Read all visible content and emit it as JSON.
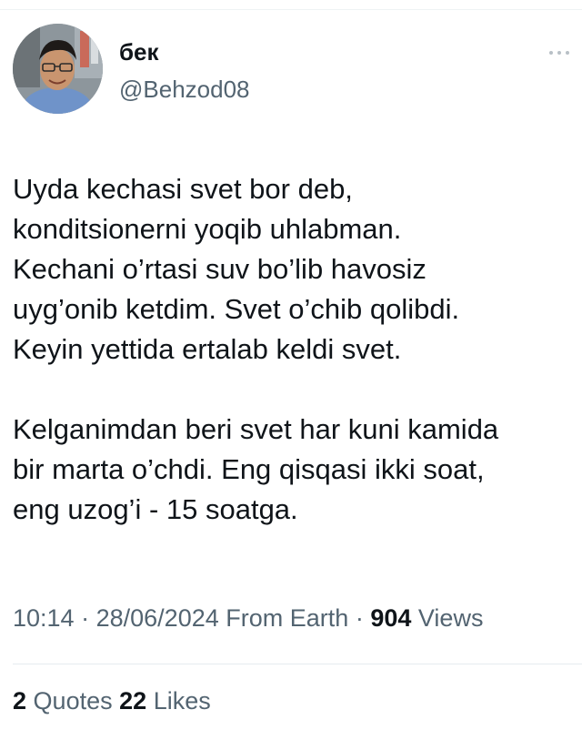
{
  "author": {
    "display_name": "бек",
    "handle": "@Behzod08"
  },
  "tweet": {
    "paragraphs": [
      "Uyda kechasi svet bor deb,\nkonditsionerni yoqib uhlabman.\nKechani o’rtasi suv bo’lib havosiz\nuyg’onib ketdim. Svet o’chib qolibdi.\nKeyin yettida ertalab keldi svet.",
      "Kelganimdan beri svet har kuni kamida\nbir marta o’chdi. Eng qisqasi ikki soat,\neng uzog’i - 15 soatga."
    ]
  },
  "meta": {
    "time": "10:14",
    "separator": "·",
    "date": "28/06/2024",
    "source": "From Earth",
    "views_count": "904",
    "views_label": "Views"
  },
  "stats": {
    "quotes_count": "2",
    "quotes_label": "Quotes",
    "likes_count": "22",
    "likes_label": "Likes"
  },
  "icons": {
    "more": "more-horizontal-icon"
  }
}
